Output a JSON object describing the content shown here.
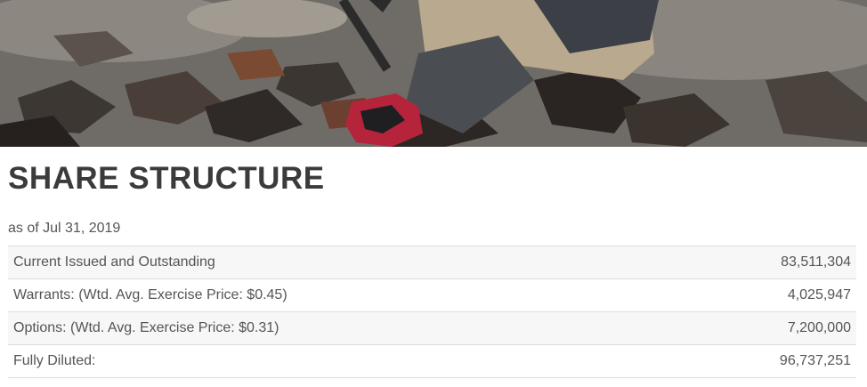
{
  "hero": {
    "image": "geologist-sampling-rocks-photo"
  },
  "section": {
    "title": "SHARE STRUCTURE",
    "as_of": "as of Jul 31, 2019"
  },
  "share_table": {
    "rows": [
      {
        "label": "Current Issued and Outstanding",
        "value": "83,511,304"
      },
      {
        "label": "Warrants: (Wtd. Avg. Exercise Price: $0.45)",
        "value": "4,025,947"
      },
      {
        "label": "Options: (Wtd. Avg. Exercise Price: $0.31)",
        "value": "7,200,000"
      },
      {
        "label": "Fully Diluted:",
        "value": "96,737,251"
      }
    ]
  }
}
